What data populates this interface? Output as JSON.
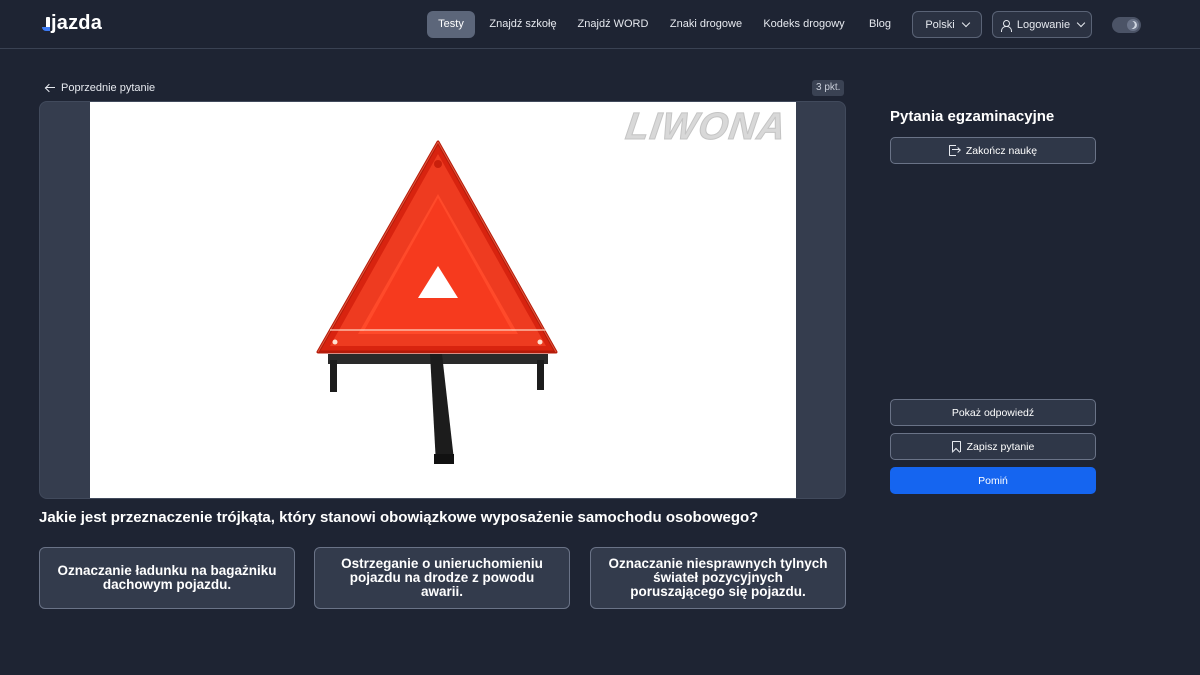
{
  "brand": {
    "name": "jazda"
  },
  "nav": {
    "items": [
      {
        "label": "Testy",
        "active": true
      },
      {
        "label": "Znajdź szkołę"
      },
      {
        "label": "Znajdź WORD"
      },
      {
        "label": "Znaki drogowe"
      },
      {
        "label": "Kodeks drogowy"
      },
      {
        "label": "Blog"
      }
    ],
    "language": "Polski",
    "login": "Logowanie",
    "theme_icon": "moon-icon"
  },
  "question_view": {
    "prev_label": "Poprzednie pytanie",
    "points": "3 pkt.",
    "image_watermark": "LIWONA",
    "question": "Jakie jest przeznaczenie trójkąta, który stanowi obowiązkowe wyposażenie samochodu osobowego?",
    "answers": [
      "Oznaczanie ładunku na bagażniku dachowym pojazdu.",
      "Ostrzeganie o unieruchomieniu pojazdu na drodze z powodu awarii.",
      "Oznaczanie niesprawnych tylnych świateł pozycyjnych poruszającego się pojazdu."
    ]
  },
  "panel": {
    "title": "Pytania egzaminacyjne",
    "end_label": "Zakończ naukę",
    "show_answer_label": "Pokaż odpowiedź",
    "save_label": "Zapisz pytanie",
    "skip_label": "Pomiń"
  },
  "colors": {
    "background": "#1e2433",
    "primary": "#1565f0",
    "triangle_red": "#e8321c"
  }
}
